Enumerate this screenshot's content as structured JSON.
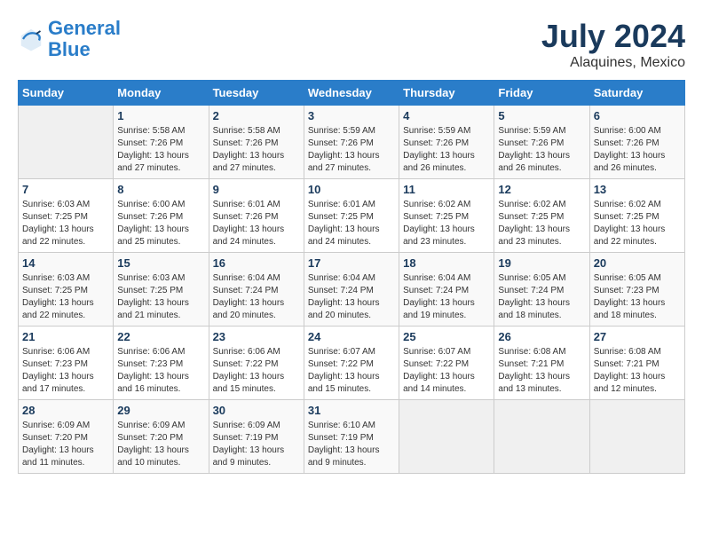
{
  "header": {
    "logo_line1": "General",
    "logo_line2": "Blue",
    "main_title": "July 2024",
    "subtitle": "Alaquines, Mexico"
  },
  "calendar": {
    "days_of_week": [
      "Sunday",
      "Monday",
      "Tuesday",
      "Wednesday",
      "Thursday",
      "Friday",
      "Saturday"
    ],
    "weeks": [
      [
        {
          "day": "",
          "info": ""
        },
        {
          "day": "1",
          "info": "Sunrise: 5:58 AM\nSunset: 7:26 PM\nDaylight: 13 hours\nand 27 minutes."
        },
        {
          "day": "2",
          "info": "Sunrise: 5:58 AM\nSunset: 7:26 PM\nDaylight: 13 hours\nand 27 minutes."
        },
        {
          "day": "3",
          "info": "Sunrise: 5:59 AM\nSunset: 7:26 PM\nDaylight: 13 hours\nand 27 minutes."
        },
        {
          "day": "4",
          "info": "Sunrise: 5:59 AM\nSunset: 7:26 PM\nDaylight: 13 hours\nand 26 minutes."
        },
        {
          "day": "5",
          "info": "Sunrise: 5:59 AM\nSunset: 7:26 PM\nDaylight: 13 hours\nand 26 minutes."
        },
        {
          "day": "6",
          "info": "Sunrise: 6:00 AM\nSunset: 7:26 PM\nDaylight: 13 hours\nand 26 minutes."
        }
      ],
      [
        {
          "day": "7",
          "info": ""
        },
        {
          "day": "8",
          "info": "Sunrise: 6:00 AM\nSunset: 7:26 PM\nDaylight: 13 hours\nand 25 minutes."
        },
        {
          "day": "9",
          "info": "Sunrise: 6:01 AM\nSunset: 7:26 PM\nDaylight: 13 hours\nand 24 minutes."
        },
        {
          "day": "10",
          "info": "Sunrise: 6:01 AM\nSunset: 7:25 PM\nDaylight: 13 hours\nand 24 minutes."
        },
        {
          "day": "11",
          "info": "Sunrise: 6:02 AM\nSunset: 7:25 PM\nDaylight: 13 hours\nand 23 minutes."
        },
        {
          "day": "12",
          "info": "Sunrise: 6:02 AM\nSunset: 7:25 PM\nDaylight: 13 hours\nand 23 minutes."
        },
        {
          "day": "13",
          "info": "Sunrise: 6:02 AM\nSunset: 7:25 PM\nDaylight: 13 hours\nand 22 minutes."
        }
      ],
      [
        {
          "day": "14",
          "info": ""
        },
        {
          "day": "15",
          "info": "Sunrise: 6:03 AM\nSunset: 7:25 PM\nDaylight: 13 hours\nand 21 minutes."
        },
        {
          "day": "16",
          "info": "Sunrise: 6:04 AM\nSunset: 7:24 PM\nDaylight: 13 hours\nand 20 minutes."
        },
        {
          "day": "17",
          "info": "Sunrise: 6:04 AM\nSunset: 7:24 PM\nDaylight: 13 hours\nand 20 minutes."
        },
        {
          "day": "18",
          "info": "Sunrise: 6:04 AM\nSunset: 7:24 PM\nDaylight: 13 hours\nand 19 minutes."
        },
        {
          "day": "19",
          "info": "Sunrise: 6:05 AM\nSunset: 7:24 PM\nDaylight: 13 hours\nand 18 minutes."
        },
        {
          "day": "20",
          "info": "Sunrise: 6:05 AM\nSunset: 7:23 PM\nDaylight: 13 hours\nand 18 minutes."
        }
      ],
      [
        {
          "day": "21",
          "info": ""
        },
        {
          "day": "22",
          "info": "Sunrise: 6:06 AM\nSunset: 7:23 PM\nDaylight: 13 hours\nand 16 minutes."
        },
        {
          "day": "23",
          "info": "Sunrise: 6:06 AM\nSunset: 7:22 PM\nDaylight: 13 hours\nand 15 minutes."
        },
        {
          "day": "24",
          "info": "Sunrise: 6:07 AM\nSunset: 7:22 PM\nDaylight: 13 hours\nand 15 minutes."
        },
        {
          "day": "25",
          "info": "Sunrise: 6:07 AM\nSunset: 7:22 PM\nDaylight: 13 hours\nand 14 minutes."
        },
        {
          "day": "26",
          "info": "Sunrise: 6:08 AM\nSunset: 7:21 PM\nDaylight: 13 hours\nand 13 minutes."
        },
        {
          "day": "27",
          "info": "Sunrise: 6:08 AM\nSunset: 7:21 PM\nDaylight: 13 hours\nand 12 minutes."
        }
      ],
      [
        {
          "day": "28",
          "info": "Sunrise: 6:09 AM\nSunset: 7:20 PM\nDaylight: 13 hours\nand 11 minutes."
        },
        {
          "day": "29",
          "info": "Sunrise: 6:09 AM\nSunset: 7:20 PM\nDaylight: 13 hours\nand 10 minutes."
        },
        {
          "day": "30",
          "info": "Sunrise: 6:09 AM\nSunset: 7:19 PM\nDaylight: 13 hours\nand 9 minutes."
        },
        {
          "day": "31",
          "info": "Sunrise: 6:10 AM\nSunset: 7:19 PM\nDaylight: 13 hours\nand 9 minutes."
        },
        {
          "day": "",
          "info": ""
        },
        {
          "day": "",
          "info": ""
        },
        {
          "day": "",
          "info": ""
        }
      ]
    ],
    "week1_sunday_info": "Sunrise: 6:03 AM\nSunset: 7:25 PM\nDaylight: 13 hours\nand 22 minutes.",
    "week2_sunday_info": "Sunrise: 6:03 AM\nSunset: 7:25 PM\nDaylight: 13 hours\nand 22 minutes.",
    "week3_sunday_info": "Sunrise: 6:06 AM\nSunset: 7:23 PM\nDaylight: 13 hours\nand 17 minutes."
  }
}
